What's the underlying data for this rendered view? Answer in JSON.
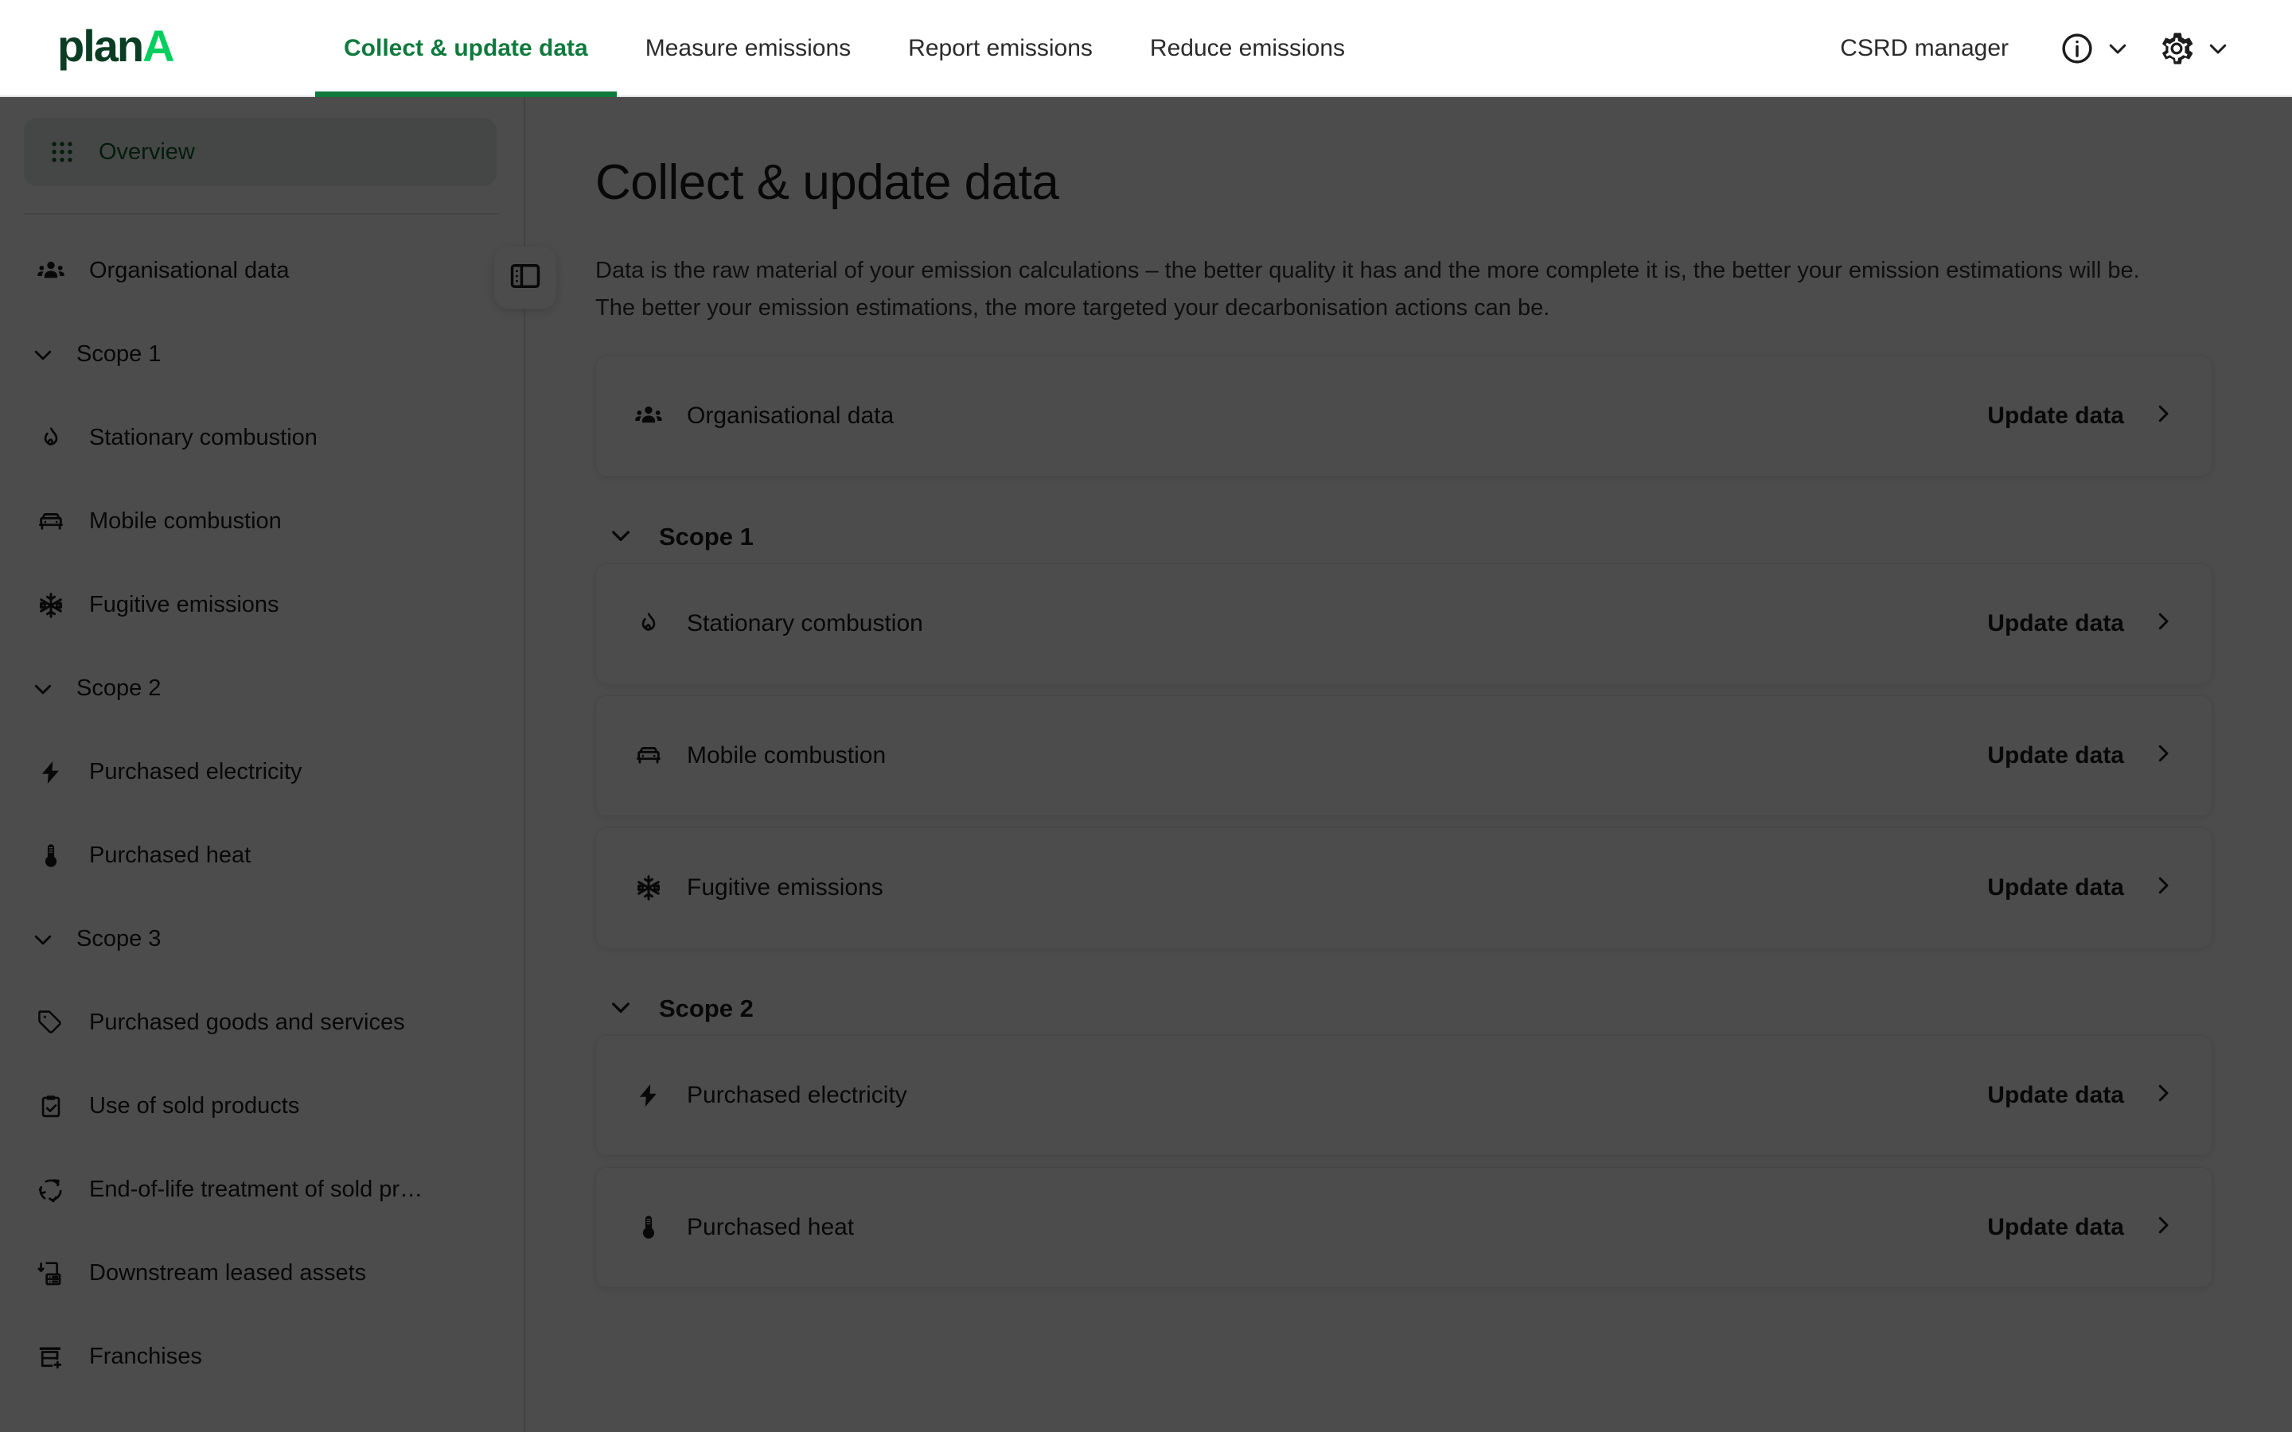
{
  "brand": {
    "name_primary": "plan",
    "name_accent": "A"
  },
  "header": {
    "tabs": [
      {
        "label": "Collect & update data",
        "active": true
      },
      {
        "label": "Measure emissions",
        "active": false
      },
      {
        "label": "Report emissions",
        "active": false
      },
      {
        "label": "Reduce emissions",
        "active": false
      }
    ],
    "role": "CSRD manager",
    "info_icon": "info-circle-icon",
    "info_chevron": "chevron-down-icon",
    "settings_icon": "gear-icon",
    "settings_chevron": "chevron-down-icon",
    "active_tab_color": "#0f7a3d"
  },
  "sidebar": {
    "overview": {
      "label": "Overview",
      "icon": "grid-dots-icon"
    },
    "collapse_toggle_icon": "panel-collapse-icon",
    "organisational": {
      "label": "Organisational data",
      "icon": "people-icon"
    },
    "groups": [
      {
        "label": "Scope 1",
        "chevron": "chevron-down-icon",
        "items": [
          {
            "label": "Stationary combustion",
            "icon": "flame-icon"
          },
          {
            "label": "Mobile combustion",
            "icon": "car-icon"
          },
          {
            "label": "Fugitive emissions",
            "icon": "snowflake-icon"
          }
        ]
      },
      {
        "label": "Scope 2",
        "chevron": "chevron-down-icon",
        "items": [
          {
            "label": "Purchased electricity",
            "icon": "bolt-icon"
          },
          {
            "label": "Purchased heat",
            "icon": "thermometer-icon"
          }
        ]
      },
      {
        "label": "Scope 3",
        "chevron": "chevron-down-icon",
        "items": [
          {
            "label": "Purchased goods and services",
            "icon": "tag-icon"
          },
          {
            "label": "Use of sold products",
            "icon": "clipboard-check-icon"
          },
          {
            "label": "End-of-life treatment of sold pr…",
            "icon": "recycle-icon"
          },
          {
            "label": "Downstream leased assets",
            "icon": "building-down-arrow-icon"
          },
          {
            "label": "Franchises",
            "icon": "store-plus-icon"
          }
        ]
      }
    ]
  },
  "main": {
    "title": "Collect & update data",
    "description": "Data is the raw material of your emission calculations – the better quality it has and the more complete it is, the better your emission estimations will be. The better your emission estimations, the more targeted your decarbonisation actions can be.",
    "update_label": "Update data",
    "chevron_right_icon": "chevron-right-icon",
    "organisational_card": {
      "label": "Organisational data",
      "icon": "people-icon"
    },
    "scopes": [
      {
        "label": "Scope 1",
        "chevron": "chevron-down-icon",
        "rows": [
          {
            "label": "Stationary combustion",
            "icon": "flame-icon"
          },
          {
            "label": "Mobile combustion",
            "icon": "car-icon"
          },
          {
            "label": "Fugitive emissions",
            "icon": "snowflake-icon"
          }
        ]
      },
      {
        "label": "Scope 2",
        "chevron": "chevron-down-icon",
        "rows": [
          {
            "label": "Purchased electricity",
            "icon": "bolt-icon"
          },
          {
            "label": "Purchased heat",
            "icon": "thermometer-icon"
          }
        ]
      }
    ]
  }
}
